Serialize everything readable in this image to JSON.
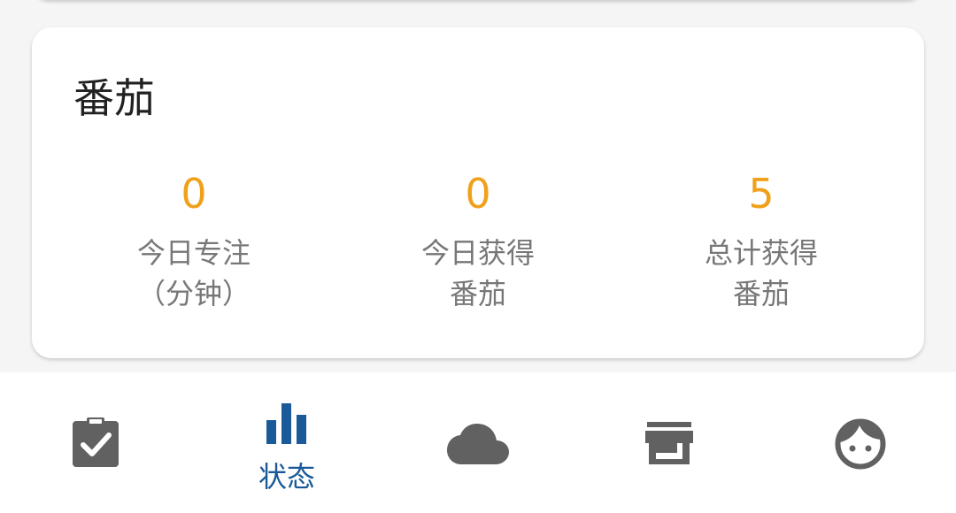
{
  "card": {
    "title": "番茄",
    "stats": [
      {
        "value": "0",
        "label_line1": "今日专注",
        "label_line2": "（分钟）"
      },
      {
        "value": "0",
        "label_line1": "今日获得",
        "label_line2": "番茄"
      },
      {
        "value": "5",
        "label_line1": "总计获得",
        "label_line2": "番茄"
      }
    ]
  },
  "bottom_nav": {
    "items": [
      {
        "icon": "clipboard-check-icon",
        "label": "",
        "active": false
      },
      {
        "icon": "bar-chart-icon",
        "label": "状态",
        "active": true
      },
      {
        "icon": "cloud-icon",
        "label": "",
        "active": false
      },
      {
        "icon": "store-icon",
        "label": "",
        "active": false
      },
      {
        "icon": "face-icon",
        "label": "",
        "active": false
      }
    ]
  },
  "colors": {
    "accent_value": "#f0a11c",
    "active_nav": "#1a5a99",
    "inactive_icon": "#616161",
    "label_gray": "#777777"
  }
}
